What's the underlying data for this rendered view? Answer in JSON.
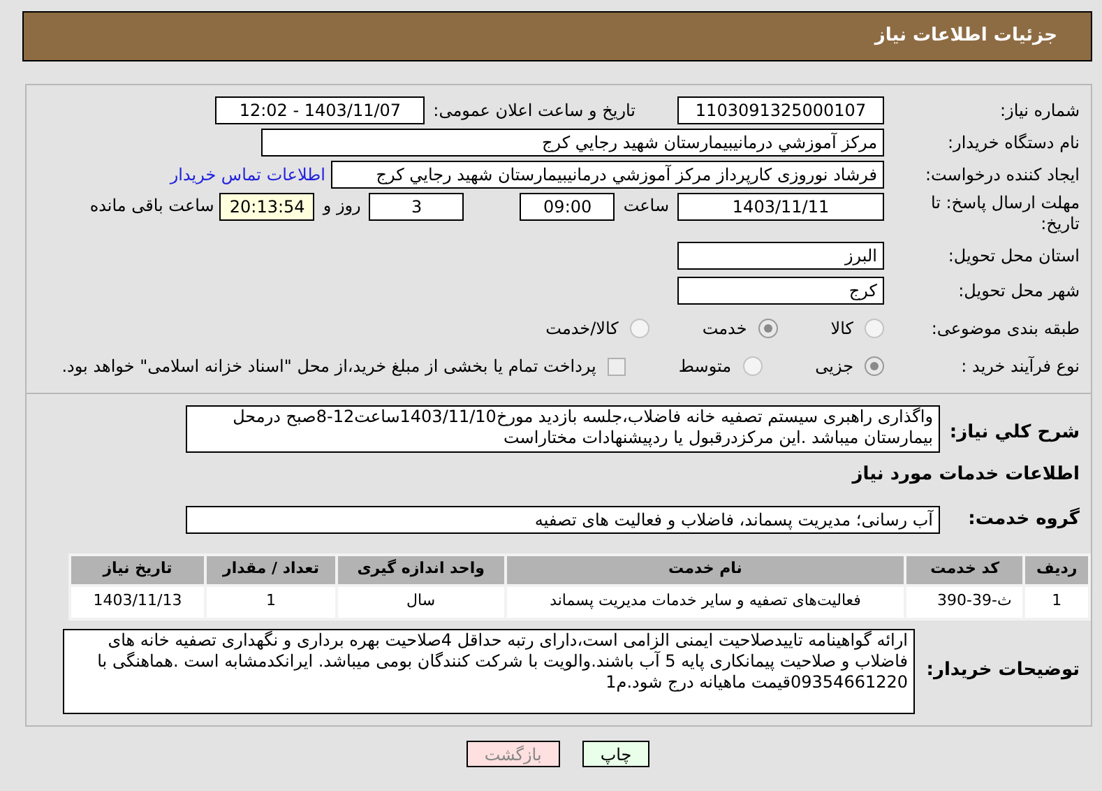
{
  "header": {
    "title": "جزئیات اطلاعات نیاز"
  },
  "need_number": {
    "label": "شماره نیاز:",
    "value": "1103091325000107"
  },
  "announce": {
    "label": "تاریخ و ساعت اعلان عمومی:",
    "value": "1403/11/07 - 12:02"
  },
  "buyer_org": {
    "label": "نام دستگاه خریدار:",
    "value": "مرکز آموزشي درمانيبيمارستان شهيد رجايي کرج"
  },
  "requester": {
    "label": "ایجاد کننده درخواست:",
    "value": "فرشاد نوروزی کارپرداز مرکز آموزشي درمانيبيمارستان شهيد رجايي کرج",
    "link": "اطلاعات تماس خریدار"
  },
  "deadline": {
    "label": "مهلت ارسال پاسخ: تا تاریخ:",
    "date": "1403/11/11",
    "time_label": "ساعت",
    "time": "09:00",
    "days": "3",
    "days_label": "روز و",
    "remaining": "20:13:54",
    "remaining_label": "ساعت باقی مانده"
  },
  "province": {
    "label": "استان محل تحویل:",
    "value": "البرز"
  },
  "city": {
    "label": "شهر محل تحویل:",
    "value": "کرج"
  },
  "category": {
    "label": "طبقه بندی موضوعی:",
    "options": [
      {
        "label": "کالا",
        "selected": false
      },
      {
        "label": "خدمت",
        "selected": true
      },
      {
        "label": "کالا/خدمت",
        "selected": false
      }
    ]
  },
  "process": {
    "label": "نوع فرآیند خرید :",
    "options": [
      {
        "label": "جزیی",
        "selected": true
      },
      {
        "label": "متوسط",
        "selected": false
      }
    ],
    "treasury": {
      "checked": false,
      "label": "پرداخت تمام یا بخشی از مبلغ خرید،از محل \"اسناد خزانه اسلامی\" خواهد بود."
    }
  },
  "description": {
    "label": "شرح کلي نیاز:",
    "value": "واگذاری راهبری سیستم تصفیه خانه فاضلاب،جلسه بازدید مورخ1403/11/10ساعت12-8صبح درمحل بیمارستان میباشد .این مرکزدرقبول یا ردپیشنهادات مختاراست"
  },
  "services_heading": "اطلاعات خدمات مورد نیاز",
  "service_group": {
    "label": "گروه خدمت:",
    "value": "آب رسانی؛ مدیریت پسماند، فاضلاب و فعالیت های تصفیه"
  },
  "table": {
    "columns": [
      "ردیف",
      "کد خدمت",
      "نام خدمت",
      "واحد اندازه گیری",
      "تعداد / مقدار",
      "تاریخ نیاز"
    ],
    "rows": [
      [
        "1",
        "ث-39-390",
        "فعالیت‌های تصفیه و سایر خدمات مدیریت پسماند",
        "سال",
        "1",
        "1403/11/13"
      ]
    ]
  },
  "buyer_notes": {
    "label": "توضیحات خریدار:",
    "value": "ارائه گواهینامه تاییدصلاحیت ایمنی الزامی است،دارای رتبه حداقل 4صلاحیت بهره برداری و نگهداری تصفیه خانه های فاضلاب و صلاحیت پیمانکاری پایه 5 آب باشند.والویت با شرکت کنندگان بومی میباشد. ایرانکدمشابه است .هماهنگی با 09354661220قیمت ماهیانه درج شود.م1"
  },
  "buttons": [
    {
      "label": "چاپ",
      "kind": "print"
    },
    {
      "label": "بازگشت",
      "kind": "back"
    }
  ]
}
